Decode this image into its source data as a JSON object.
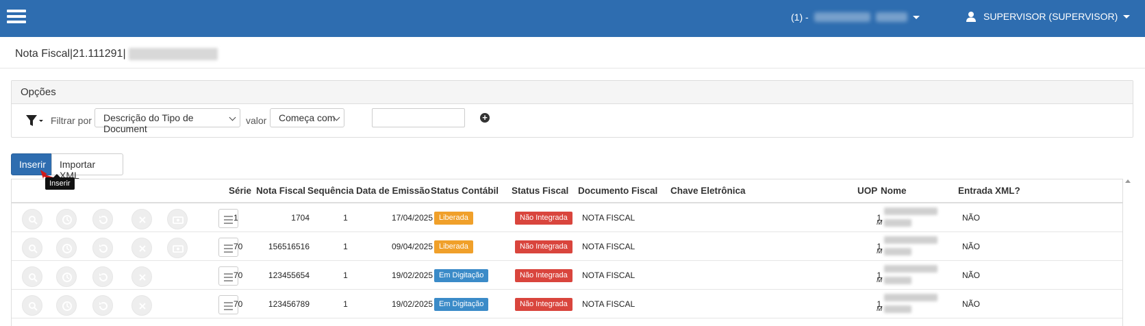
{
  "header": {
    "company_prefix": "(1) -",
    "user_label": "SUPERVISOR (SUPERVISOR)"
  },
  "page": {
    "title": "Nota Fiscal|21.111291|"
  },
  "options": {
    "title": "Opções",
    "filter_by_label": "Filtrar por",
    "filter_field": "Descrição do Tipo de Document",
    "value_label": "valor",
    "operator": "Começa com",
    "value_input": ""
  },
  "actions": {
    "insert_label": "Inserir",
    "import_label": "Importar XML",
    "tooltip": "Inserir"
  },
  "table": {
    "columns": [
      "Série",
      "Nota Fiscal",
      "Sequência",
      "Data de Emissão",
      "Status Contábil",
      "Status Fiscal",
      "Documento Fiscal",
      "Chave Eletrônica",
      "UOP",
      "Nome",
      "Entrada XML?"
    ],
    "rows": [
      {
        "serie": "1",
        "nota": "1704",
        "seq": "1",
        "data": "17/04/2025",
        "status_contabil": "Liberada",
        "status_fiscal": "Não Integrada",
        "documento": "NOTA FISCAL",
        "chave": "",
        "uop": "1",
        "nome_mark": "M",
        "xml": "NÃO"
      },
      {
        "serie": "70",
        "nota": "156516516",
        "seq": "1",
        "data": "09/04/2025",
        "status_contabil": "Liberada",
        "status_fiscal": "Não Integrada",
        "documento": "NOTA FISCAL",
        "chave": "",
        "uop": "1",
        "nome_mark": "M",
        "xml": "NÃO"
      },
      {
        "serie": "70",
        "nota": "123455654",
        "seq": "1",
        "data": "19/02/2025",
        "status_contabil": "Em Digitação",
        "status_fiscal": "Não Integrada",
        "documento": "NOTA FISCAL",
        "chave": "",
        "uop": "1",
        "nome_mark": "M",
        "xml": "NÃO"
      },
      {
        "serie": "70",
        "nota": "123456789",
        "seq": "1",
        "data": "19/02/2025",
        "status_contabil": "Em Digitação",
        "status_fiscal": "Não Integrada",
        "documento": "NOTA FISCAL",
        "chave": "",
        "uop": "1",
        "nome_mark": "M",
        "xml": "NÃO"
      }
    ]
  },
  "colors": {
    "header_bg": "#2e6db0",
    "liberada": "#f0a02a",
    "em_digitacao": "#3b8bc8",
    "nao_integrada": "#d9453d"
  }
}
